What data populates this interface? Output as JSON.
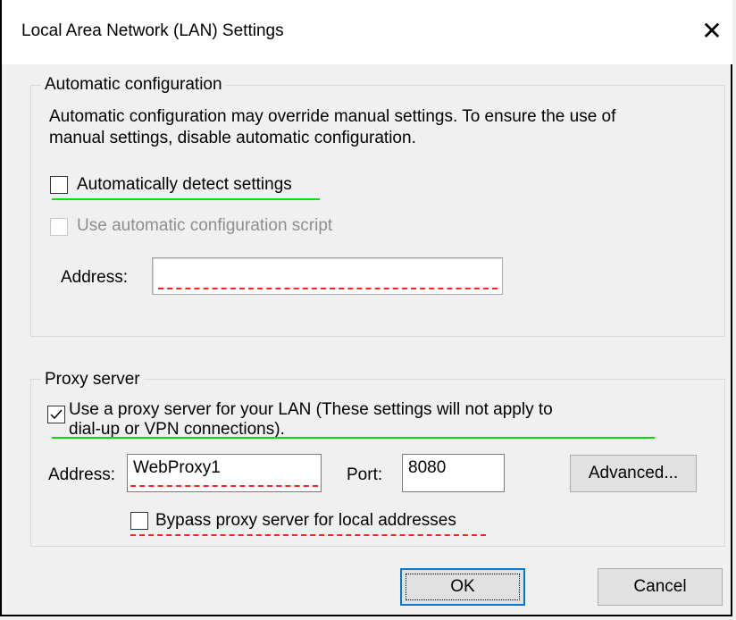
{
  "window": {
    "title": "Local Area Network (LAN) Settings",
    "close_glyph": "✕"
  },
  "auto_config": {
    "group_label": "Automatic configuration",
    "description_line1": "Automatic configuration may override manual settings.  To ensure the use of",
    "description_line2": "manual settings, disable automatic configuration.",
    "detect_label": "Automatically detect settings",
    "detect_checked": false,
    "script_label": "Use automatic configuration script",
    "script_checked": false,
    "address_label": "Address:",
    "address_value": ""
  },
  "proxy": {
    "group_label": "Proxy server",
    "use_proxy_line1": "Use a proxy server for your LAN (These settings will not apply to",
    "use_proxy_line2": "dial-up or VPN connections).",
    "use_proxy_checked": true,
    "address_label": "Address:",
    "address_value": "WebProxy1",
    "port_label": "Port:",
    "port_value": "8080",
    "advanced_label": "Advanced...",
    "bypass_label": "Bypass proxy server for local addresses",
    "bypass_checked": false
  },
  "footer": {
    "ok_label": "OK",
    "cancel_label": "Cancel"
  },
  "colors": {
    "highlight_green": "#00e000",
    "highlight_red": "#ff2020",
    "default_button_border": "#0078d7"
  }
}
